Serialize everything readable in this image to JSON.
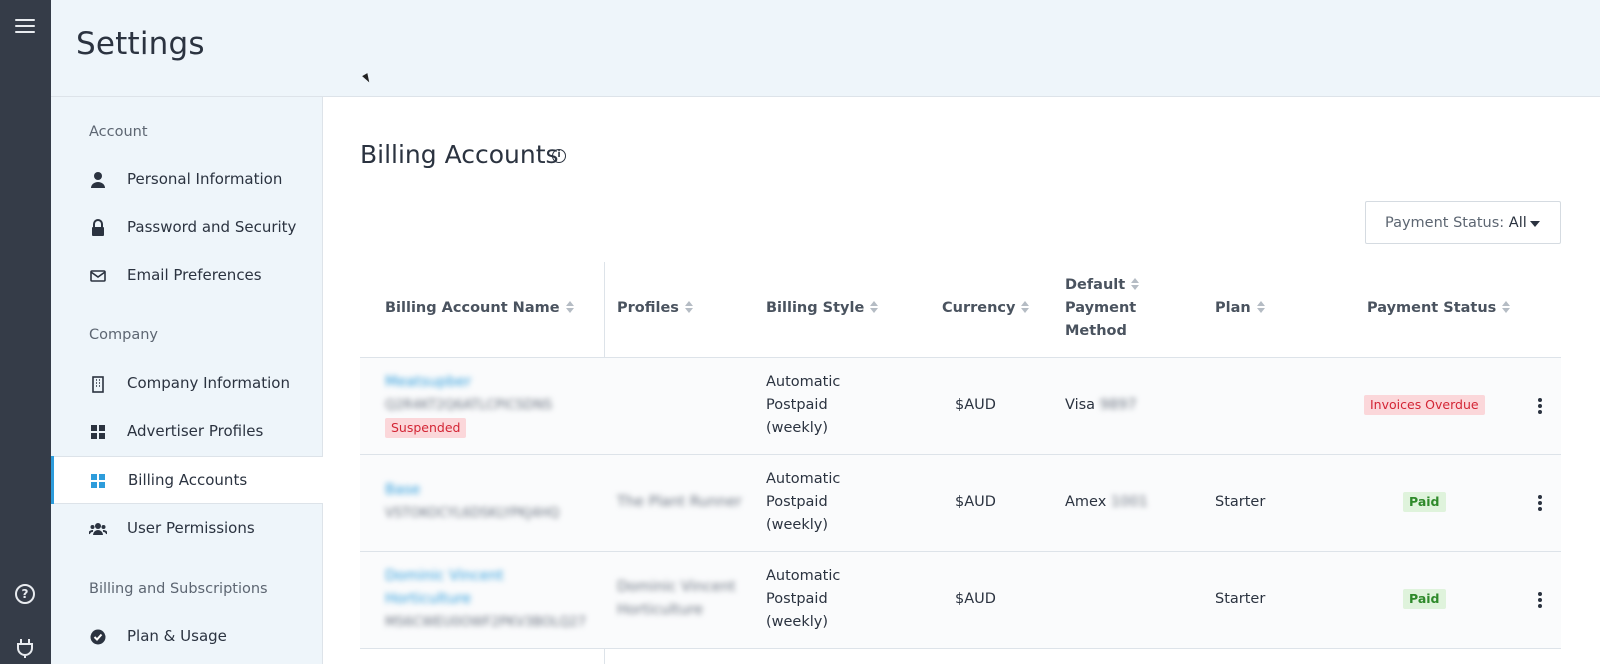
{
  "page": {
    "title": "Settings"
  },
  "sidebar": {
    "sections": [
      {
        "label": "Account"
      },
      {
        "label": "Company"
      },
      {
        "label": "Billing and Subscriptions"
      }
    ],
    "items": [
      {
        "label": "Personal Information"
      },
      {
        "label": "Password and Security"
      },
      {
        "label": "Email Preferences"
      },
      {
        "label": "Company Information"
      },
      {
        "label": "Advertiser Profiles"
      },
      {
        "label": "Billing Accounts"
      },
      {
        "label": "User Permissions"
      },
      {
        "label": "Plan & Usage"
      }
    ],
    "active_item": "Billing Accounts"
  },
  "main": {
    "title": "Billing Accounts",
    "filter": {
      "label": "Payment Status:",
      "value": "All"
    },
    "columns": [
      "Billing Account Name",
      "Profiles",
      "Billing Style",
      "Currency",
      "Default Payment Method",
      "Plan",
      "Payment Status"
    ],
    "column_lines": {
      "default_payment": [
        "Default",
        "Payment",
        "Method"
      ]
    },
    "rows": [
      {
        "name_lines": [
          "Meatsupber"
        ],
        "id": "Q2R4KT2Q6ATLCPICSDNS",
        "status_badge": "Suspended",
        "profiles_lines": [],
        "billing_style_lines": [
          "Automatic",
          "Postpaid",
          "(weekly)"
        ],
        "currency": "$AUD",
        "payment_brand": "Visa",
        "payment_last4": "9897",
        "plan": "",
        "payment_status": "Invoices Overdue"
      },
      {
        "name_lines": [
          "Base"
        ],
        "id": "VSTOKOCYL6DSKLYPKJ4HQ",
        "status_badge": "",
        "profiles_lines": [
          "The Plant Runner"
        ],
        "billing_style_lines": [
          "Automatic",
          "Postpaid",
          "(weekly)"
        ],
        "currency": "$AUD",
        "payment_brand": "Amex",
        "payment_last4": "1001",
        "plan": "Starter",
        "payment_status": "Paid"
      },
      {
        "name_lines": [
          "Dominic Vincent",
          "Horticulture"
        ],
        "id": "MS6CWEU0OWF2PKV3BOLQ27",
        "status_badge": "",
        "profiles_lines": [
          "Dominic Vincent",
          "Horticulture"
        ],
        "billing_style_lines": [
          "Automatic",
          "Postpaid",
          "(weekly)"
        ],
        "currency": "$AUD",
        "payment_brand": "",
        "payment_last4": "",
        "plan": "Starter",
        "payment_status": "Paid"
      }
    ]
  },
  "icons": {
    "menu": "hamburger-icon",
    "help": "question-circle-icon",
    "plug": "plug-icon",
    "info": "info-icon",
    "sort": "sort-icon",
    "kebab": "kebab-icon"
  },
  "colors": {
    "rail": "#353c48",
    "header_bg": "#eef5fa",
    "accent": "#2d9cdb",
    "danger_bg": "#fbd7da",
    "danger_text": "#d32535",
    "success_bg": "#dff3dc",
    "success_text": "#2f8a2b"
  }
}
